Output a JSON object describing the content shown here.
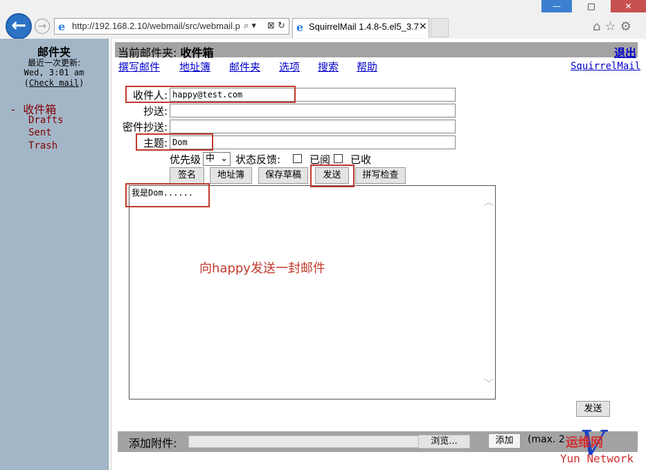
{
  "browser": {
    "url": "http://192.168.2.10/webmail/src/webmail.p",
    "tab_title": "SquirrelMail 1.4.8-5.el5_3.7",
    "tab_close": "×",
    "window_buttons": {
      "minimize": "—",
      "maximize": "□",
      "close": "✕"
    }
  },
  "left": {
    "title": "邮件夹",
    "last_update_label": "最近一次更新:",
    "last_update_time": "Wed, 3:01 am",
    "check_mail": "Check mail",
    "folders": [
      "- 收件箱",
      "Drafts",
      "Sent",
      "Trash"
    ]
  },
  "header": {
    "current_folder_label": "当前邮件夹:",
    "current_folder": "收件箱",
    "logout": "退出",
    "nav": [
      "撰写邮件",
      "地址簿",
      "邮件夹",
      "选项",
      "搜索",
      "帮助"
    ],
    "brand": "SquirrelMail"
  },
  "compose": {
    "to_label": "收件人:",
    "to_value": "happy@test.com",
    "cc_label": "抄送:",
    "cc_value": "",
    "bcc_label": "密件抄送:",
    "bcc_value": "",
    "subject_label": "主题:",
    "subject_value": "Dom",
    "priority_label": "优先级",
    "priority_value": "中",
    "receipt_label": "状态反馈:",
    "read_label": "已阅",
    "delivered_label": "已收",
    "buttons": [
      "签名",
      "地址簿",
      "保存草稿",
      "发送",
      "拼写检查"
    ],
    "body": "我是Dom......",
    "send_bottom": "发送"
  },
  "annotation": "向happy发送一封邮件",
  "attach": {
    "label": "添加附件:",
    "browse": "浏览...",
    "add": "添加",
    "max": "(max. 2"
  },
  "watermark": {
    "line1": "运维网",
    "line2": "Yun Network",
    "logo": "V"
  }
}
